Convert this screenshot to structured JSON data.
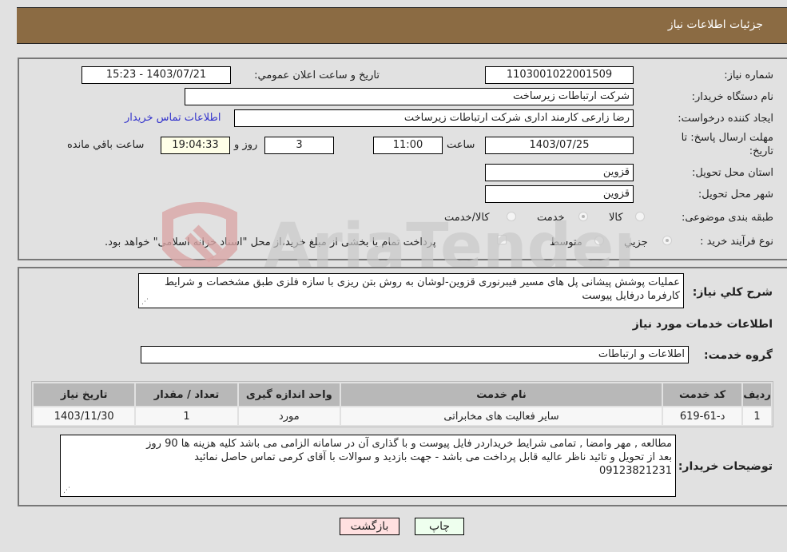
{
  "header": {
    "title": "جزئیات اطلاعات نیاز"
  },
  "fields": {
    "need_number_label": "شماره نیاز:",
    "need_number": "1103001022001509",
    "announce_label": "تاريخ و ساعت اعلان عمومي:",
    "announce_value": "1403/07/21 - 15:23",
    "buyer_org_label": "نام دستگاه خریدار:",
    "buyer_org": "شرکت ارتباطات زیرساخت",
    "creator_label": "ایجاد کننده درخواست:",
    "creator": "رضا زارعی کارمند اداری شرکت ارتباطات زیرساخت",
    "contact_link": "اطلاعات تماس خریدار",
    "deadline_label_1": "مهلت ارسال پاسخ: تا",
    "deadline_label_2": "تاریخ:",
    "deadline_date": "1403/07/25",
    "time_label": "ساعت",
    "deadline_time": "11:00",
    "days": "3",
    "days_label": "روز و",
    "remaining": "19:04:33",
    "remaining_label": "ساعت باقي مانده",
    "province_label": "استان محل تحویل:",
    "province": "قزوین",
    "city_label": "شهر محل تحویل:",
    "city": "قزوین"
  },
  "category": {
    "label": "طبقه بندی موضوعی:",
    "options": [
      {
        "label": "کالا",
        "selected": false
      },
      {
        "label": "خدمت",
        "selected": true
      },
      {
        "label": "کالا/خدمت",
        "selected": false
      }
    ]
  },
  "purchase_type": {
    "label": "نوع فرآیند خرید :",
    "options": [
      {
        "label": "جزيي",
        "selected": true
      },
      {
        "label": "متوسط",
        "selected": false
      }
    ],
    "treasury_checkbox_label": "پرداخت تمام یا بخشی از مبلغ خرید،از محل \"اسناد خزانه اسلامی\" خواهد بود.",
    "treasury_checked": false
  },
  "description": {
    "label": "شرح کلي نياز:",
    "text": "عملیات پوشش پیشانی پل های مسیر فیبرنوری قزوین-لوشان به روش بتن ریزی با سازه فلزی طبق مشخصات و شرایط کارفرما درفایل پیوست"
  },
  "services_section": {
    "title": "اطلاعات خدمات مورد نیاز",
    "group_label": "گروه خدمت:",
    "group_value": "اطلاعات و ارتباطات"
  },
  "table": {
    "headers": [
      "ردیف",
      "کد خدمت",
      "نام خدمت",
      "واحد اندازه گیری",
      "تعداد / مقدار",
      "تاریخ نیاز"
    ],
    "rows": [
      [
        "1",
        "د-61-619",
        "سایر فعالیت های مخابراتی",
        "مورد",
        "1",
        "1403/11/30"
      ]
    ]
  },
  "buyer_notes": {
    "label": "توضیحات خریدار:",
    "lines": [
      "مطالعه , مهر وامضا , تمامی شرایط خریداردر فایل پیوست و با گذاری آن در سامانه الزامی می باشد کلیه هزینه ها 90 روز",
      "بعد از تحویل و تائید ناظر عالیه قابل پرداخت می باشد - جهت بازدید و سوالات با آقای کرمی تماس حاصل نمائید",
      "09123821231"
    ]
  },
  "buttons": {
    "print": "چاپ",
    "back": "بازگشت"
  },
  "watermark": {
    "text": "AriaTender.neT"
  },
  "colors": {
    "header": "#8b6b43",
    "print_bg": "#eeffee",
    "back_bg": "#ffe0e0",
    "link": "#3333cc"
  }
}
